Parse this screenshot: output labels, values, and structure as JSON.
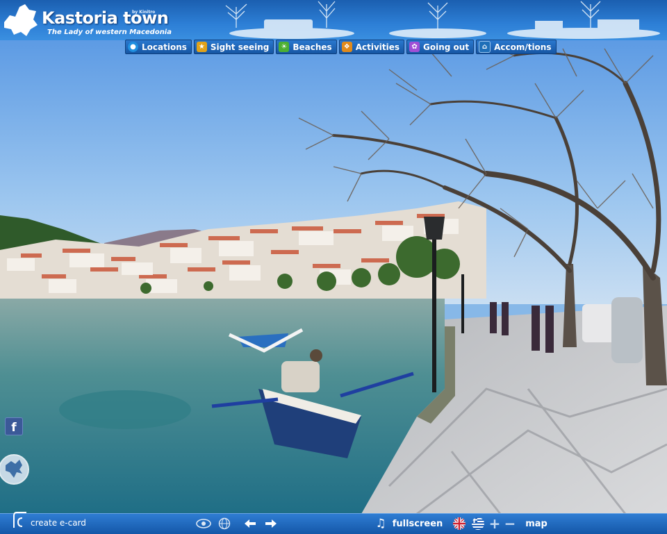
{
  "header": {
    "title": "Kastoria town",
    "by_line": "by Kinitro",
    "subtitle": "The Lady of western Macedonia"
  },
  "nav": {
    "items": [
      {
        "label": "Locations",
        "icon": "globe-icon",
        "color": "#1f8fe0"
      },
      {
        "label": "Sight seeing",
        "icon": "star-icon",
        "color": "#e0a21b"
      },
      {
        "label": "Beaches",
        "icon": "beach-icon",
        "color": "#4caf32"
      },
      {
        "label": "Activities",
        "icon": "activity-icon",
        "color": "#e08a1b"
      },
      {
        "label": "Going out",
        "icon": "butterfly-icon",
        "color": "#a04fd6"
      },
      {
        "label": "Accom/tions",
        "icon": "accommodation-icon",
        "color": "#1f6fb8"
      }
    ]
  },
  "sidebar": {
    "facebook_icon_text": "f"
  },
  "bottom_bar": {
    "ecard_label": "create e-card",
    "fullscreen_label": "fullscreen",
    "map_label": "map",
    "plus_label": "+",
    "minus_label": "−"
  },
  "colors": {
    "bar_blue": "#1d62b4",
    "sky": "#7fb4ea",
    "lake": "#3f8a9a"
  }
}
